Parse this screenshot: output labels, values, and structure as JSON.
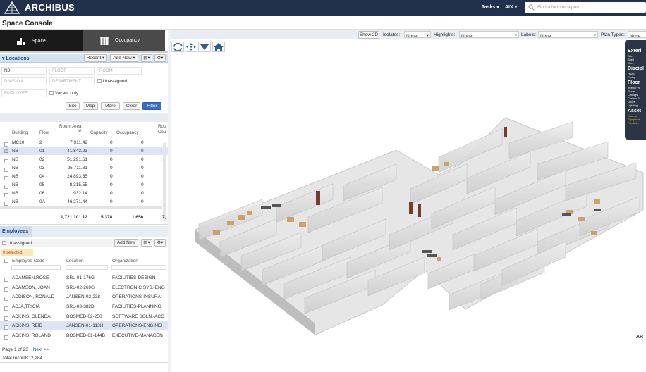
{
  "app": {
    "brand": "ARCHIBUS",
    "tasks_menu": "Tasks ▾",
    "user_menu": "AIX ▾",
    "search_placeholder": "Find a form or report"
  },
  "page": {
    "title": "Space Console"
  },
  "tabs": [
    {
      "label": "Space"
    },
    {
      "label": "Occupancy"
    }
  ],
  "locations": {
    "title": "Locations",
    "recent_button": "Recent ▾",
    "add_new_button": "Add New ▾",
    "filters": {
      "building": "NB",
      "floor": "FLOOR",
      "room": "ROOM",
      "division": "DIVISION",
      "department": "DEPARTMENT",
      "employee": "EMPLOYEE",
      "unassigned_label": "Unassigned",
      "vacant_label": "Vacant only"
    },
    "buttons": {
      "site": "Site",
      "map": "Map",
      "more": "More",
      "clear": "Clear",
      "filter": "Filter"
    },
    "headers": {
      "building": "Building",
      "floor": "Floor",
      "room_area": "Room Area",
      "area_unit": "ft²",
      "capacity": "Capacity",
      "occupancy": "Occupancy",
      "room_count_1": "Roo",
      "room_count_2": "Cou"
    },
    "rows": [
      {
        "building": "MC10",
        "floor": "2",
        "area": "7,911.42",
        "capacity": "0",
        "occupancy": "0",
        "count": ""
      },
      {
        "building": "NB",
        "floor": "01",
        "area": "41,843.23",
        "capacity": "0",
        "occupancy": "0",
        "count": ":"
      },
      {
        "building": "NB",
        "floor": "02",
        "area": "51,291.61",
        "capacity": "0",
        "occupancy": "0",
        "count": ":"
      },
      {
        "building": "NB",
        "floor": "03",
        "area": "25,711.31",
        "capacity": "0",
        "occupancy": "0",
        "count": ""
      },
      {
        "building": "NB",
        "floor": "04",
        "area": "24,893.35",
        "capacity": "0",
        "occupancy": "0",
        "count": ""
      },
      {
        "building": "NB",
        "floor": "05",
        "area": "8,315.55",
        "capacity": "0",
        "occupancy": "0",
        "count": ""
      },
      {
        "building": "NB",
        "floor": "06",
        "area": "932.14",
        "capacity": "0",
        "occupancy": "0",
        "count": ""
      },
      {
        "building": "NB",
        "floor": "0A",
        "area": "46,271.44",
        "capacity": "0",
        "occupancy": "0",
        "count": ":"
      }
    ],
    "totals": {
      "area": "1,721,101.12",
      "capacity": "5,378",
      "occupancy": "1,656",
      "count": "7,"
    }
  },
  "employees": {
    "tab_label": "Employees",
    "unassigned_label": "Unassigned",
    "add_new_button": "Add New",
    "selected_count": "0 selected",
    "headers": {
      "code": "Employee Code",
      "location": "Location",
      "organization": "Organization"
    },
    "rows": [
      {
        "code": "ADAMSEN,ROSE",
        "location": "SRL-01-176G",
        "org": "FACILITIES-DESIGN"
      },
      {
        "code": "ADAMSON, JOAN",
        "location": "SRL-02-269G",
        "org": "ELECTRONIC SYS.-ENG"
      },
      {
        "code": "ADDISON, RONALD",
        "location": "JANSEN-02-238",
        "org": "OPERATIONS-INSURAI"
      },
      {
        "code": "ADJA,TRICIA",
        "location": "SRL-03-382D",
        "org": "FACILITIES-PLANNING"
      },
      {
        "code": "ADKINS, GLENDA",
        "location": "BOSMED-02-250",
        "org": "SOFTWARE SOLN.-ACC"
      },
      {
        "code": "ADKINS, REID",
        "location": "JANSEN-01-113H",
        "org": "OPERATIONS-ENGINEI"
      },
      {
        "code": "ADKINS, ROLAND",
        "location": "BOSMED-01-144B",
        "org": "EXECUTIVE-MANAGEN"
      }
    ],
    "pager": {
      "page": "Page 1 of 23",
      "next": "Next >>"
    },
    "total": "Total records: 2,284"
  },
  "viewer": {
    "show2d": "Show 2D",
    "isolates_label": "Isolates:",
    "isolates_value": "None",
    "highlights_label": "Highlights:",
    "highlights_value": "None",
    "labels_label": "Labels:",
    "labels_value": "None",
    "plantypes_label": "Plan Types:",
    "plantypes_value": "None",
    "watermark": "AR",
    "legend": {
      "exterior": "Exteri",
      "exterior_items": [
        "Site",
        "Shell",
        "Core"
      ],
      "discipline": "Discipl",
      "discipline_items": [
        "HVAC",
        "Piping"
      ],
      "floor": "Floor",
      "floor_items": [
        "Interior W",
        "Floors",
        "Ceilings",
        "Curtain P",
        "Doors",
        "Lighting"
      ],
      "assets": "Asset",
      "assets_items": [
        "Rooms",
        "Equipmen",
        "Furniture"
      ]
    }
  }
}
